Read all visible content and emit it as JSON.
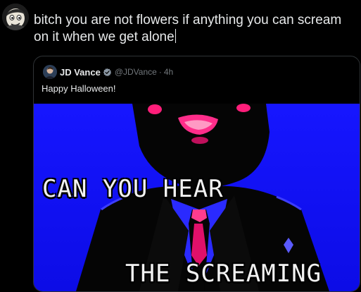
{
  "draft": {
    "text": "bitch you are not flowers if anything you can scream on it when we get alone"
  },
  "quoted_tweet": {
    "display_name": "JD Vance",
    "handle": "@JDVance",
    "separator": "·",
    "timestamp": "4h",
    "text": "Happy Halloween!",
    "media": {
      "caption_top": "CAN YOU HEAR",
      "caption_bottom": "THE SCREAMING"
    }
  },
  "icons": {
    "avatar": "cartoon-avatar",
    "verified": "verified-badge-icon"
  },
  "colors": {
    "background": "#000000",
    "text_primary": "#e7e9ea",
    "text_secondary": "#71767b",
    "border": "#2f3336",
    "verified_blue": "#1d9bf0",
    "media_blue": "#1a1aff"
  }
}
